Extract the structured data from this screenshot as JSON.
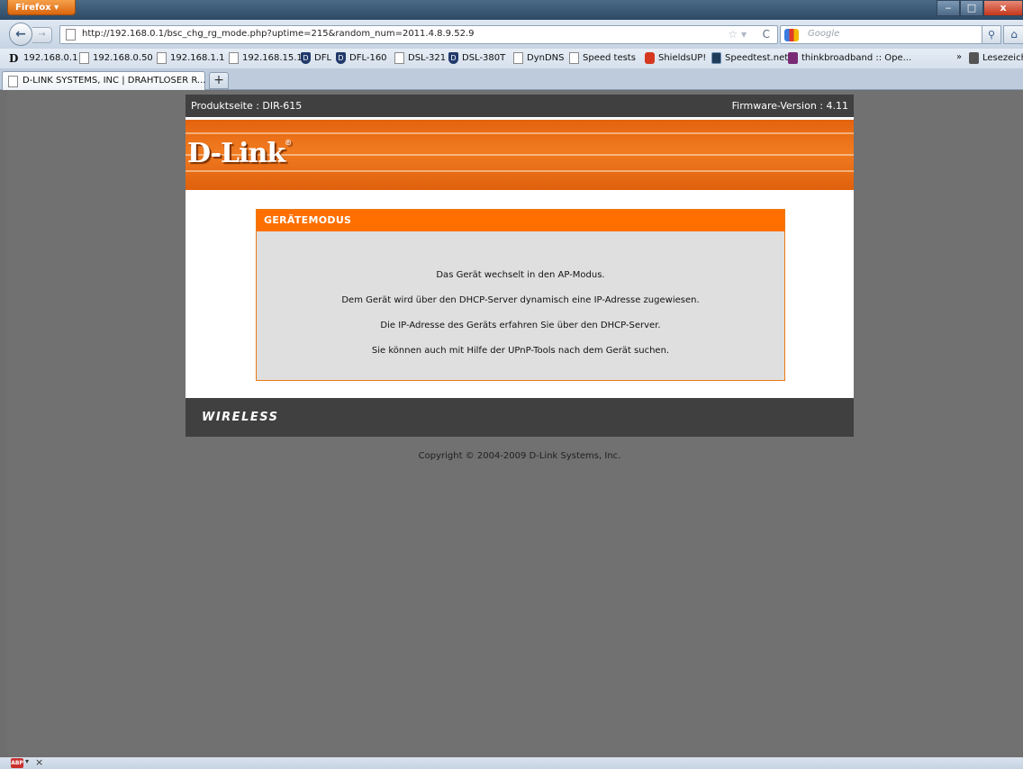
{
  "browser": {
    "app_button": "Firefox",
    "url": "http://192.168.0.1/bsc_chg_rg_mode.php?uptime=215&random_num=2011.4.8.9.52.9",
    "search_placeholder": "Google",
    "new_tab": "+",
    "tab_title": "D-LINK SYSTEMS, INC | DRAHTLOSER R...",
    "bookmarks": [
      {
        "label": "192.168.0.1",
        "icon": "dlink-d-icon"
      },
      {
        "label": "192.168.0.50",
        "icon": "page-icon"
      },
      {
        "label": "192.168.1.1",
        "icon": "page-icon"
      },
      {
        "label": "192.168.15.1",
        "icon": "page-icon"
      },
      {
        "label": "DFL",
        "icon": "shield-icon"
      },
      {
        "label": "DFL-160",
        "icon": "shield-icon"
      },
      {
        "label": "DSL-321",
        "icon": "page-icon"
      },
      {
        "label": "DSL-380T",
        "icon": "shield-icon"
      },
      {
        "label": "DynDNS",
        "icon": "page-icon"
      },
      {
        "label": "Speed tests",
        "icon": "page-icon"
      },
      {
        "label": "ShieldsUP!",
        "icon": "shieldsup-icon"
      },
      {
        "label": "Speedtest.net",
        "icon": "speedtest-icon"
      },
      {
        "label": "thinkbroadband :: Ope...",
        "icon": "thinkbroadband-icon"
      }
    ],
    "bookmarks_overflow": "»",
    "bookmarks_folder": "Lesezeichen"
  },
  "router_page": {
    "product_label": "Produktseite : DIR-615",
    "firmware_label": "Firmware-Version : 4.11",
    "logo_text": "D-Link",
    "section_title": "GERÄTEMODUS",
    "messages": [
      "Das Gerät wechselt in den AP-Modus.",
      "Dem Gerät wird über den DHCP-Server dynamisch eine IP-Adresse zugewiesen.",
      "Die IP-Adresse des Geräts erfahren Sie über den DHCP-Server.",
      "Sie können auch mit Hilfe der UPnP-Tools nach dem Gerät suchen."
    ],
    "footer_brand": "WIRELESS",
    "copyright": "Copyright © 2004-2009 D-Link Systems, Inc."
  },
  "colors": {
    "accent_orange": "#ff6f00",
    "dark_bar": "#404040",
    "background_gray": "#717171"
  }
}
